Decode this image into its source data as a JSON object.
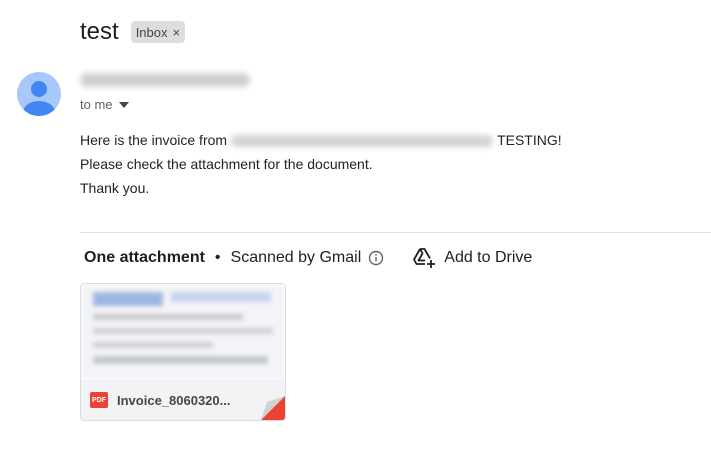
{
  "email": {
    "subject": "test",
    "label": "Inbox",
    "label_remove": "×",
    "recipient": "to me",
    "body": {
      "line1_before": "Here is the invoice from",
      "line1_after": "TESTING!",
      "line2": "Please check the attachment for the document.",
      "line3": "Thank you."
    }
  },
  "attachments": {
    "count_label": "One attachment",
    "separator": "•",
    "scan_label": "Scanned by Gmail",
    "add_to_drive": "Add to Drive",
    "files": [
      {
        "name": "Invoice_8060320...",
        "type_badge": "PDF"
      }
    ]
  },
  "colors": {
    "avatar_bg": "#a8c7fa",
    "avatar_fg": "#4285f4",
    "pdf_red": "#ea4335",
    "chip_bg": "#dddddd"
  }
}
